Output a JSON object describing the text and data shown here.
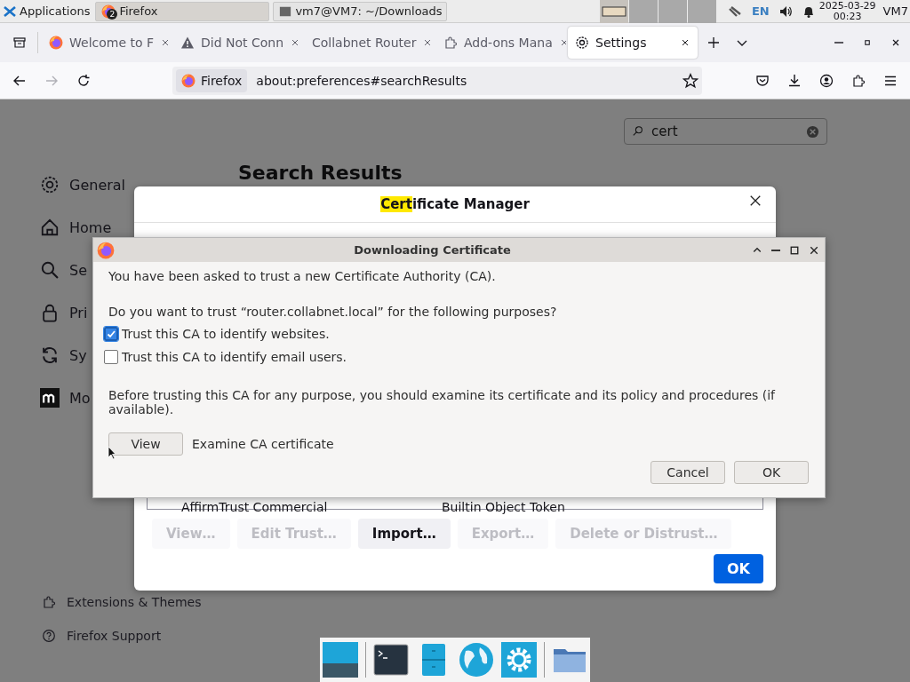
{
  "top_panel": {
    "apps_menu": "Applications",
    "tasks": [
      {
        "label": "Firefox",
        "badge": "2",
        "selected": true
      },
      {
        "label": "vm7@VM7: ~/Downloads",
        "selected": false
      }
    ],
    "workspaces": [
      {
        "selected": true
      },
      {
        "selected": false
      },
      {
        "selected": false
      },
      {
        "selected": false
      }
    ],
    "keyboard": "EN",
    "date": "2025-03-29",
    "time": "00:23",
    "user": "VM7"
  },
  "tabs": [
    {
      "label": "Welcome to F",
      "kind": "firefox",
      "selected": false
    },
    {
      "label": "Did Not Conn",
      "kind": "warning",
      "selected": false
    },
    {
      "label": "Collabnet Router",
      "kind": "none",
      "selected": false
    },
    {
      "label": "Add-ons Mana",
      "kind": "puzzle",
      "selected": false
    },
    {
      "label": "Settings",
      "kind": "gear",
      "selected": true
    }
  ],
  "nav": {
    "identity": "Firefox",
    "url": "about:preferences#searchResults"
  },
  "search": {
    "value": "cert"
  },
  "sidebar": {
    "items": [
      {
        "label": "General",
        "kind": "gear"
      },
      {
        "label": "Home",
        "kind": "home"
      },
      {
        "label": "Se",
        "kind": "search"
      },
      {
        "label": "Pri",
        "kind": "lock"
      },
      {
        "label": "Sy",
        "kind": "sync"
      },
      {
        "label": "Mo",
        "kind": "mozilla"
      }
    ],
    "footer": [
      {
        "label": "Extensions & Themes",
        "kind": "puzzle"
      },
      {
        "label": "Firefox Support",
        "kind": "help"
      }
    ]
  },
  "heading": "Search Results",
  "cert_manager": {
    "title_parts": [
      {
        "text": "Cert",
        "highlighted": true
      },
      {
        "text": "ificate Manager",
        "highlighted": false
      }
    ],
    "row": [
      "AffirmTrust Commercial",
      "Builtin Object Token"
    ],
    "buttons": [
      {
        "label": "View…",
        "disabled": true
      },
      {
        "label": "Edit Trust…",
        "disabled": true
      },
      {
        "label": "Import…",
        "disabled": false
      },
      {
        "label": "Export…",
        "disabled": true
      },
      {
        "label": "Delete or Distrust…",
        "disabled": true
      }
    ],
    "ok": "OK"
  },
  "download_dialog": {
    "title": "Downloading Certificate",
    "intro": "You have been asked to trust a new Certificate Authority (CA).",
    "question": "Do you want to trust “router.collabnet.local” for the following purposes?",
    "options": [
      {
        "label": "Trust this CA to identify websites.",
        "checked": true
      },
      {
        "label": "Trust this CA to identify email users.",
        "checked": false
      }
    ],
    "warning": "Before trusting this CA for any purpose, you should examine its certificate and its policy and procedures (if available).",
    "view_button": "View",
    "view_label": "Examine CA certificate",
    "cancel": "Cancel",
    "ok": "OK"
  }
}
